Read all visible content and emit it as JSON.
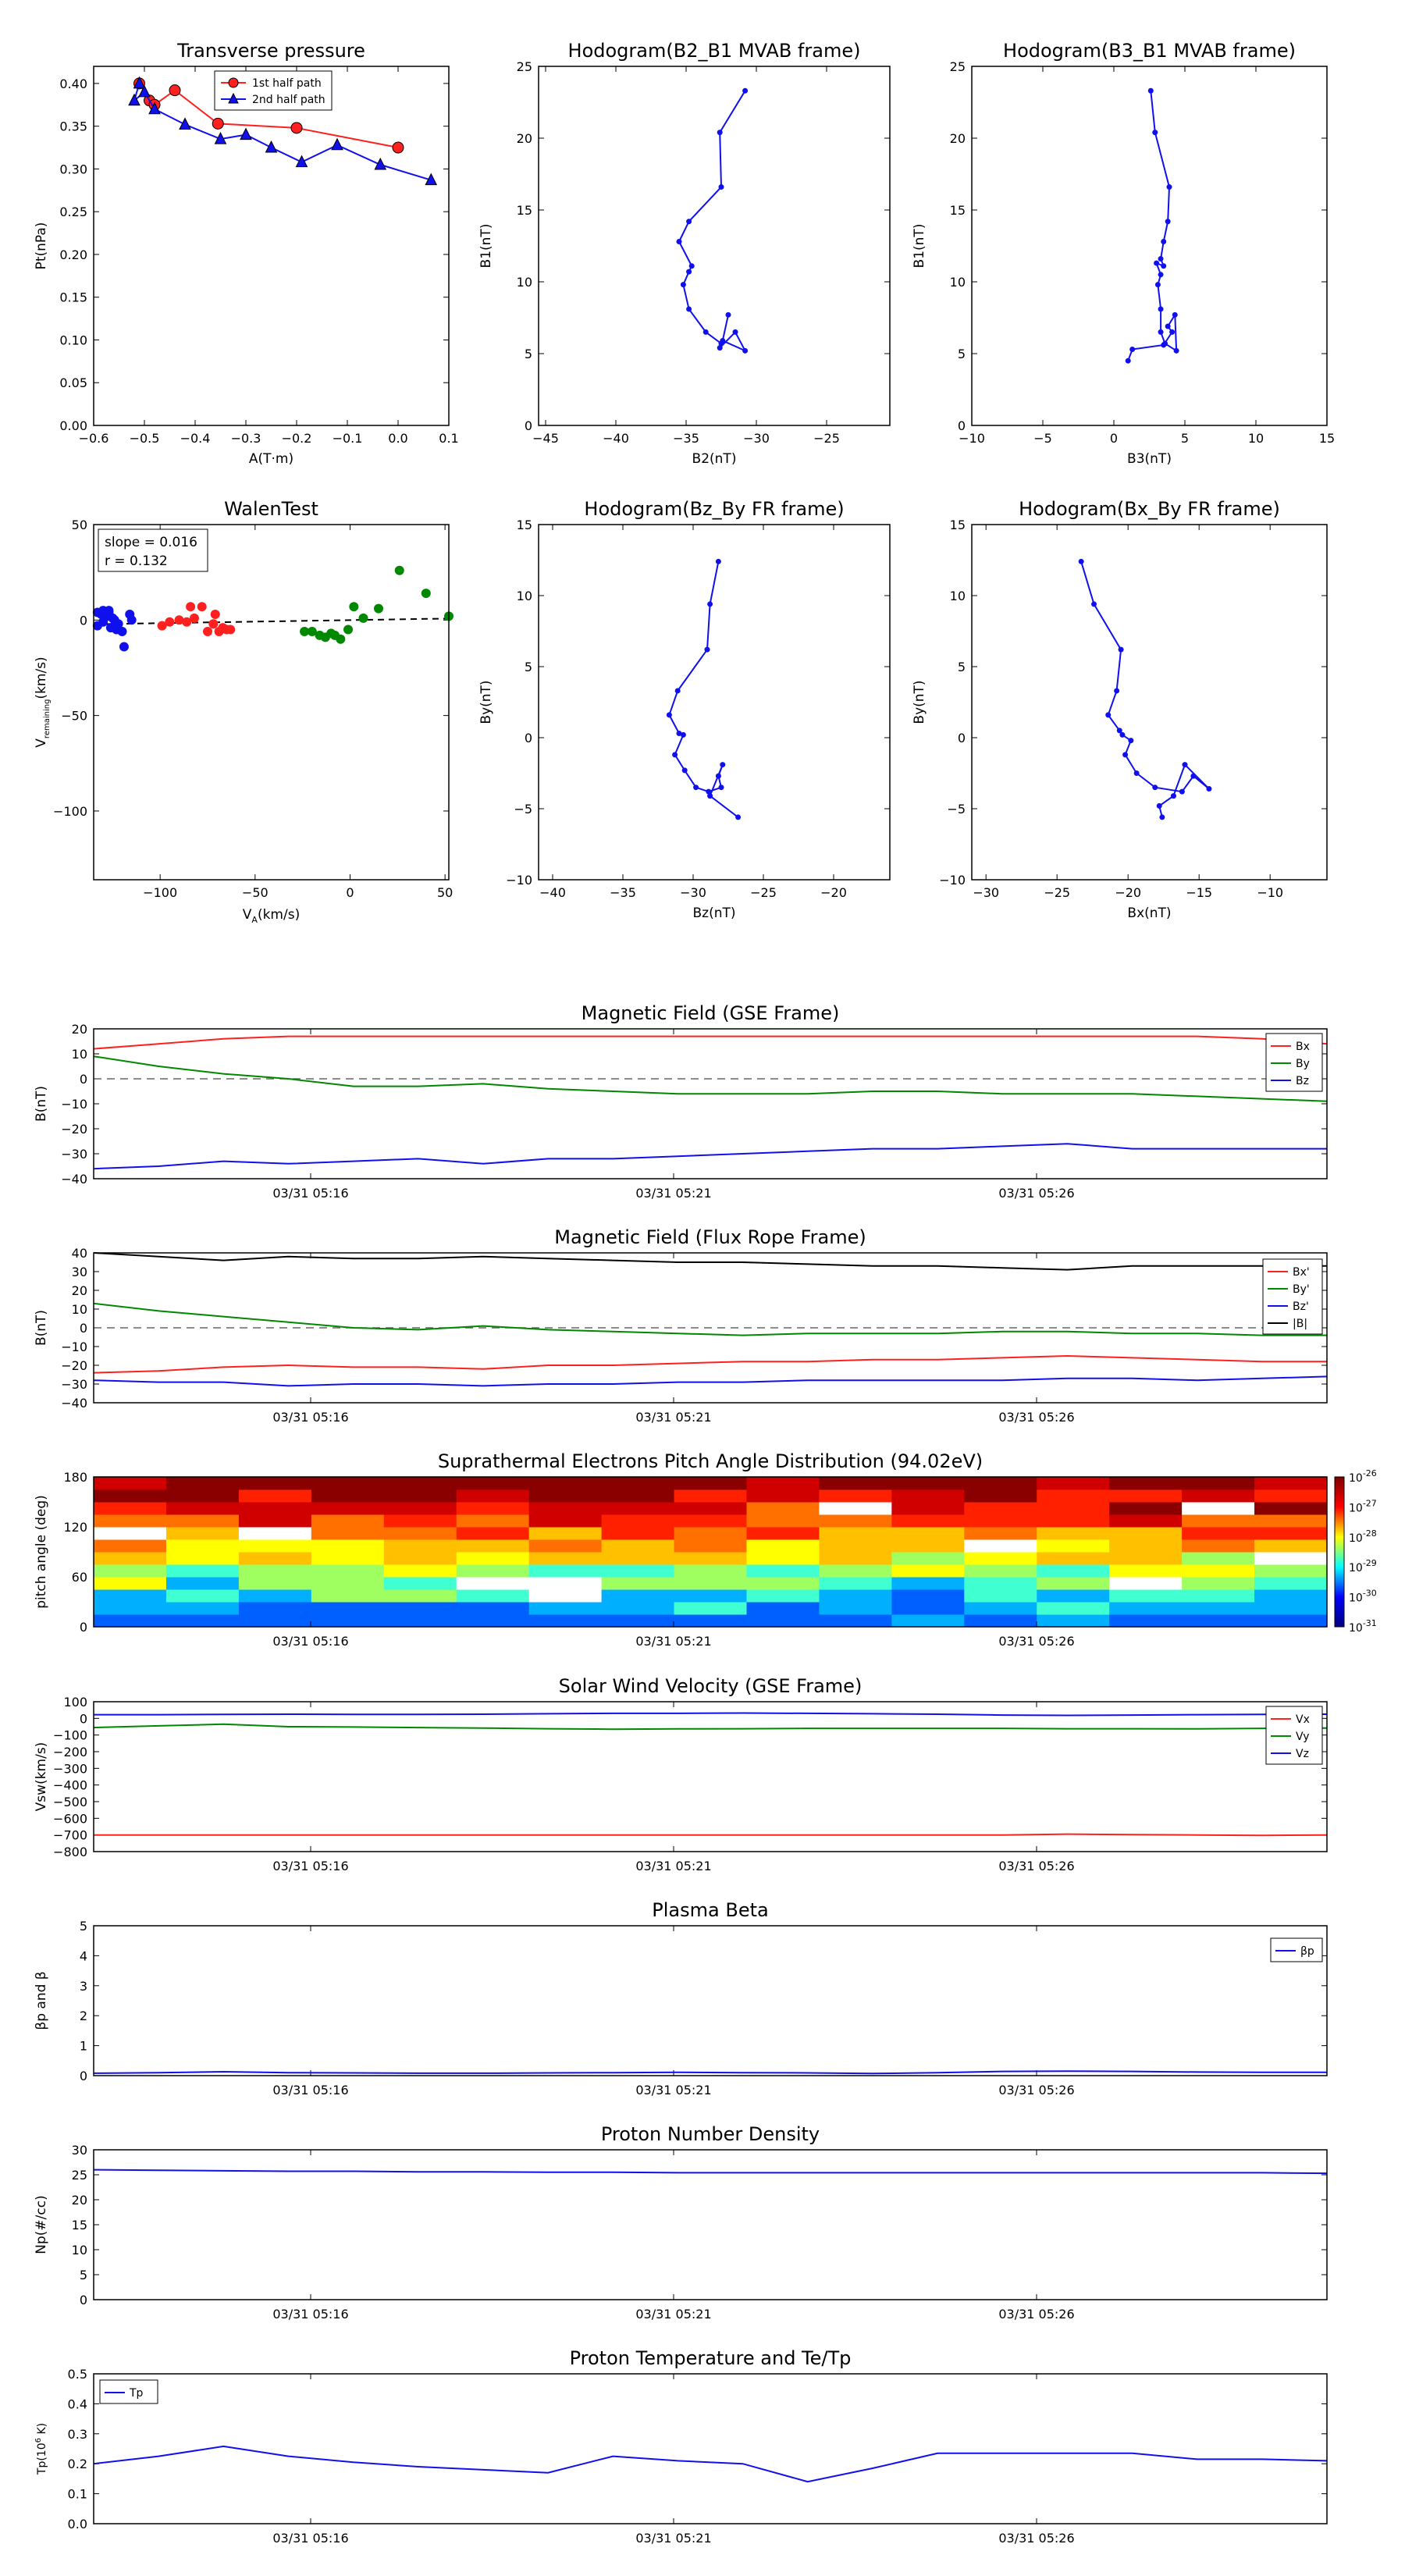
{
  "colors": {
    "red": "#ff2020",
    "green": "#008800",
    "blue": "#1010ee",
    "black": "#000000"
  },
  "time_ticks": [
    "03/31 05:16",
    "03/31 05:21",
    "03/31 05:26"
  ],
  "colorbar": {
    "labels": [
      "10^-26",
      "10^-27",
      "10^-28",
      "10^-29",
      "10^-30",
      "10^-31"
    ]
  },
  "chart_data": [
    {
      "id": "pt",
      "type": "line",
      "title": "Transverse pressure",
      "xlabel": "A(T·m)",
      "ylabel": "Pt(nPa)",
      "xlim": [
        -0.6,
        0.1
      ],
      "ylim": [
        0,
        0.42
      ],
      "xticks": [
        -0.6,
        -0.5,
        -0.4,
        -0.3,
        -0.2,
        -0.1,
        0.0,
        0.1
      ],
      "xtick_labels": [
        "−0.6",
        "−0.5",
        "−0.4",
        "−0.3",
        "−0.2",
        "−0.1",
        "0.0",
        "0.1"
      ],
      "yticks": [
        0,
        0.05,
        0.1,
        0.15,
        0.2,
        0.25,
        0.3,
        0.35,
        0.4
      ],
      "ytick_labels": [
        "0.00",
        "0.05",
        "0.10",
        "0.15",
        "0.20",
        "0.25",
        "0.30",
        "0.35",
        "0.40"
      ],
      "legend": "top-center",
      "series": [
        {
          "name": "1st half path",
          "color": "red",
          "marker": "circle",
          "x": [
            -0.51,
            -0.49,
            -0.48,
            -0.44,
            -0.355,
            -0.2,
            0.0
          ],
          "y": [
            0.4,
            0.38,
            0.375,
            0.392,
            0.353,
            0.348,
            0.325
          ]
        },
        {
          "name": "2nd half path",
          "color": "blue",
          "marker": "triangle",
          "x": [
            -0.51,
            -0.52,
            -0.5,
            -0.48,
            -0.42,
            -0.35,
            -0.3,
            -0.25,
            -0.19,
            -0.12,
            -0.035,
            0.065
          ],
          "y": [
            0.4,
            0.38,
            0.39,
            0.37,
            0.352,
            0.335,
            0.34,
            0.325,
            0.308,
            0.328,
            0.305,
            0.287
          ]
        }
      ]
    },
    {
      "id": "h1",
      "type": "line",
      "title": "Hodogram(B2_B1 MVAB frame)",
      "xlabel": "B2(nT)",
      "ylabel": "B1(nT)",
      "xlim": [
        -45.5,
        -20.5
      ],
      "ylim": [
        0,
        25
      ],
      "xticks": [
        -45,
        -40,
        -35,
        -30,
        -25
      ],
      "xtick_labels": [
        "−45",
        "−40",
        "−35",
        "−30",
        "−25"
      ],
      "yticks": [
        0,
        5,
        10,
        15,
        20,
        25
      ],
      "ytick_labels": [
        "0",
        "5",
        "10",
        "15",
        "20",
        "25"
      ],
      "series": [
        {
          "color": "blue",
          "marker": "dot",
          "x": [
            -30.8,
            -32.6,
            -32.5,
            -34.8,
            -35.5,
            -34.6,
            -34.8,
            -35.2,
            -34.8,
            -33.6,
            -32.5,
            -32.6,
            -31.5,
            -30.8,
            -32.4,
            -32.0
          ],
          "y": [
            23.3,
            20.4,
            16.6,
            14.2,
            12.8,
            11.1,
            10.7,
            9.8,
            8.1,
            6.5,
            5.7,
            5.4,
            6.5,
            5.2,
            5.9,
            7.7
          ]
        }
      ]
    },
    {
      "id": "h2",
      "type": "line",
      "title": "Hodogram(B3_B1 MVAB frame)",
      "xlabel": "B3(nT)",
      "ylabel": "B1(nT)",
      "xlim": [
        -10,
        15
      ],
      "ylim": [
        0,
        25
      ],
      "xticks": [
        -10,
        -5,
        0,
        5,
        10,
        15
      ],
      "xtick_labels": [
        "−10",
        "−5",
        "0",
        "5",
        "10",
        "15"
      ],
      "yticks": [
        0,
        5,
        10,
        15,
        20,
        25
      ],
      "ytick_labels": [
        "0",
        "5",
        "10",
        "15",
        "20",
        "25"
      ],
      "series": [
        {
          "color": "blue",
          "marker": "dot",
          "x": [
            2.6,
            2.9,
            3.9,
            3.8,
            3.5,
            3.3,
            3.5,
            3.0,
            3.3,
            3.1,
            3.3,
            3.3,
            3.6,
            4.4,
            4.3,
            3.8,
            4.1,
            3.5,
            1.3,
            1.0
          ],
          "y": [
            23.3,
            20.4,
            16.6,
            14.2,
            12.8,
            11.6,
            11.1,
            11.3,
            10.5,
            9.8,
            8.1,
            6.5,
            5.7,
            5.2,
            7.7,
            6.9,
            6.5,
            5.6,
            5.3,
            4.5
          ]
        }
      ]
    },
    {
      "id": "walen",
      "type": "scatter",
      "title": "WalenTest",
      "xlabel": "V_A(km/s)",
      "ylabel": "V_remaining(km/s)",
      "xlim": [
        -135,
        52
      ],
      "ylim": [
        -136,
        50
      ],
      "xticks": [
        -100,
        -50,
        0,
        50
      ],
      "xtick_labels": [
        "−100",
        "−50",
        "0",
        "50"
      ],
      "yticks": [
        50,
        0,
        -50,
        -100
      ],
      "ytick_labels": [
        "50",
        "0",
        "−50",
        "−100"
      ],
      "annotation": {
        "slope": "slope = 0.016",
        "r": "r = 0.132"
      },
      "fit": {
        "x": [
          -135,
          52
        ],
        "y": [
          -2.2,
          0.8
        ]
      },
      "series": [
        {
          "color": "blue",
          "x": [
            -133,
            -131,
            -130,
            -128,
            -127,
            -126,
            -125,
            -124,
            -124,
            -123,
            -122,
            -120,
            -119,
            -116,
            -133,
            -130,
            -127,
            -115
          ],
          "y": [
            4,
            3,
            5,
            2,
            4,
            -4,
            1,
            0,
            -3,
            -5,
            -2,
            -6,
            -14,
            3,
            -3,
            -1,
            5,
            0
          ]
        },
        {
          "color": "red",
          "x": [
            -99,
            -95,
            -90,
            -86,
            -84,
            -82,
            -78,
            -75,
            -72,
            -71,
            -69,
            -67,
            -65,
            -63
          ],
          "y": [
            -3,
            -1,
            0,
            -1,
            7,
            1,
            7,
            -6,
            -2,
            3,
            -6,
            -4,
            -5,
            -5
          ]
        },
        {
          "color": "green",
          "x": [
            -24,
            -20,
            -16,
            -13,
            -10,
            -8,
            -5,
            -1,
            2,
            7,
            15,
            26,
            40,
            52
          ],
          "y": [
            -6,
            -6,
            -8,
            -9,
            -7,
            -8,
            -10,
            -5,
            7,
            1,
            6,
            26,
            14,
            2
          ]
        }
      ]
    },
    {
      "id": "h3",
      "type": "line",
      "title": "Hodogram(Bz_By FR frame)",
      "xlabel": "Bz(nT)",
      "ylabel": "By(nT)",
      "xlim": [
        -41,
        -16
      ],
      "ylim": [
        -10,
        15
      ],
      "xticks": [
        -40,
        -35,
        -30,
        -25,
        -20
      ],
      "xtick_labels": [
        "−40",
        "−35",
        "−30",
        "−25",
        "−20"
      ],
      "yticks": [
        -10,
        -5,
        0,
        5,
        10,
        15
      ],
      "ytick_labels": [
        "−10",
        "−5",
        "0",
        "5",
        "10",
        "15"
      ],
      "series": [
        {
          "color": "blue",
          "marker": "dot",
          "x": [
            -28.2,
            -28.8,
            -29.0,
            -31.1,
            -31.7,
            -31.0,
            -30.7,
            -31.3,
            -30.6,
            -29.8,
            -28.9,
            -28.0,
            -28.2,
            -27.9,
            -28.8,
            -26.8
          ],
          "y": [
            12.4,
            9.4,
            6.2,
            3.3,
            1.6,
            0.3,
            0.2,
            -1.2,
            -2.3,
            -3.5,
            -3.8,
            -3.5,
            -2.7,
            -1.9,
            -4.1,
            -5.6
          ]
        }
      ]
    },
    {
      "id": "h4",
      "type": "line",
      "title": "Hodogram(Bx_By FR frame)",
      "xlabel": "Bx(nT)",
      "ylabel": "By(nT)",
      "xlim": [
        -31,
        -6
      ],
      "ylim": [
        -10,
        15
      ],
      "xticks": [
        -30,
        -25,
        -20,
        -15,
        -10
      ],
      "xtick_labels": [
        "−30",
        "−25",
        "−20",
        "−15",
        "−10"
      ],
      "yticks": [
        -10,
        -5,
        0,
        5,
        10,
        15
      ],
      "ytick_labels": [
        "−10",
        "−5",
        "0",
        "5",
        "10",
        "15"
      ],
      "series": [
        {
          "color": "blue",
          "marker": "dot",
          "x": [
            -23.3,
            -22.4,
            -20.5,
            -20.8,
            -21.4,
            -20.6,
            -20.4,
            -19.8,
            -20.2,
            -19.4,
            -18.1,
            -16.2,
            -15.4,
            -14.3,
            -16.0,
            -16.8,
            -17.8,
            -17.6
          ],
          "y": [
            12.4,
            9.4,
            6.2,
            3.3,
            1.6,
            0.5,
            0.2,
            -0.2,
            -1.2,
            -2.5,
            -3.5,
            -3.8,
            -2.7,
            -3.6,
            -1.9,
            -4.1,
            -4.8,
            -5.6
          ]
        }
      ]
    },
    {
      "id": "mag_gse",
      "type": "line",
      "title": "Magnetic Field (GSE Frame)",
      "ylabel": "B(nT)",
      "ylim": [
        -40,
        20
      ],
      "yticks": [
        20,
        10,
        0,
        -10,
        -20,
        -30,
        -40
      ],
      "ytick_labels": [
        "20",
        "10",
        "0",
        "−10",
        "−20",
        "−30",
        "−40"
      ],
      "zero_line": true,
      "legend": "top-right",
      "series": [
        {
          "name": "Bx",
          "color": "red",
          "values": [
            12,
            14,
            16,
            17,
            17,
            17,
            17,
            17,
            17,
            17,
            17,
            17,
            17,
            17,
            17,
            17,
            17,
            17,
            16,
            14
          ]
        },
        {
          "name": "By",
          "color": "green",
          "values": [
            9,
            5,
            2,
            0,
            -3,
            -3,
            -2,
            -4,
            -5,
            -6,
            -6,
            -6,
            -5,
            -5,
            -6,
            -6,
            -6,
            -7,
            -8,
            -9
          ]
        },
        {
          "name": "Bz",
          "color": "blue",
          "values": [
            -36,
            -35,
            -33,
            -34,
            -33,
            -32,
            -34,
            -32,
            -32,
            -31,
            -30,
            -29,
            -28,
            -28,
            -27,
            -26,
            -28,
            -28,
            -28,
            -28
          ]
        }
      ]
    },
    {
      "id": "mag_fr",
      "type": "line",
      "title": "Magnetic Field (Flux Rope Frame)",
      "ylabel": "B(nT)",
      "ylim": [
        -40,
        40
      ],
      "yticks": [
        40,
        30,
        20,
        10,
        0,
        -10,
        -20,
        -30,
        -40
      ],
      "ytick_labels": [
        "40",
        "30",
        "20",
        "10",
        "0",
        "−10",
        "−20",
        "−30",
        "−40"
      ],
      "zero_line": true,
      "legend": "top-right",
      "series": [
        {
          "name": "Bx'",
          "color": "red",
          "values": [
            -24,
            -23,
            -21,
            -20,
            -21,
            -21,
            -22,
            -20,
            -20,
            -19,
            -18,
            -18,
            -17,
            -17,
            -16,
            -15,
            -16,
            -17,
            -18,
            -18
          ]
        },
        {
          "name": "By'",
          "color": "green",
          "values": [
            13,
            9,
            6,
            3,
            0,
            -1,
            1,
            -1,
            -2,
            -3,
            -4,
            -3,
            -3,
            -3,
            -2,
            -2,
            -3,
            -3,
            -4,
            -4
          ]
        },
        {
          "name": "Bz'",
          "color": "blue",
          "values": [
            -28,
            -29,
            -29,
            -31,
            -30,
            -30,
            -31,
            -30,
            -30,
            -29,
            -29,
            -28,
            -28,
            -28,
            -28,
            -27,
            -27,
            -28,
            -27,
            -26
          ]
        },
        {
          "name": "|B|",
          "color": "black",
          "values": [
            40,
            38,
            36,
            38,
            37,
            37,
            38,
            37,
            36,
            35,
            35,
            34,
            33,
            33,
            32,
            31,
            33,
            33,
            33,
            33
          ]
        }
      ]
    },
    {
      "id": "pad",
      "type": "heatmap",
      "title": "Suprathermal Electrons Pitch Angle Distribution (94.02eV)",
      "ylabel": "pitch angle (deg)",
      "ylim": [
        0,
        180
      ],
      "yticks": [
        180,
        120,
        60,
        0
      ],
      "ytick_labels": [
        "180",
        "120",
        "60",
        "0"
      ],
      "cols": 17,
      "rows": 12
    },
    {
      "id": "vsw",
      "type": "line",
      "title": "Solar Wind Velocity (GSE Frame)",
      "ylabel": "Vsw(km/s)",
      "ylim": [
        -800,
        100
      ],
      "yticks": [
        100,
        0,
        -100,
        -200,
        -300,
        -400,
        -500,
        -600,
        -700,
        -800
      ],
      "ytick_labels": [
        "100",
        "0",
        "−100",
        "−200",
        "−300",
        "−400",
        "−500",
        "−600",
        "−700",
        "−800"
      ],
      "legend": "top-right",
      "series": [
        {
          "name": "Vx",
          "color": "red",
          "values": [
            -700,
            -700,
            -700,
            -700,
            -700,
            -700,
            -700,
            -700,
            -700,
            -700,
            -700,
            -700,
            -700,
            -700,
            -700,
            -695,
            -698,
            -700,
            -703,
            -700
          ]
        },
        {
          "name": "Vy",
          "color": "green",
          "values": [
            -55,
            -45,
            -35,
            -50,
            -52,
            -55,
            -58,
            -62,
            -65,
            -63,
            -62,
            -60,
            -60,
            -60,
            -60,
            -62,
            -62,
            -63,
            -60,
            -58
          ]
        },
        {
          "name": "Vz",
          "color": "blue",
          "values": [
            22,
            22,
            24,
            25,
            24,
            24,
            25,
            28,
            30,
            30,
            32,
            30,
            28,
            25,
            20,
            18,
            20,
            22,
            24,
            25
          ]
        }
      ]
    },
    {
      "id": "beta",
      "type": "line",
      "title": "Plasma Beta",
      "ylabel": "βp and β",
      "ylim": [
        0,
        5
      ],
      "yticks": [
        5,
        4,
        3,
        2,
        1,
        0
      ],
      "ytick_labels": [
        "5",
        "4",
        "3",
        "2",
        "1",
        "0"
      ],
      "legend": "top-right",
      "series": [
        {
          "name": "βp",
          "color": "blue",
          "values": [
            0.08,
            0.1,
            0.13,
            0.1,
            0.09,
            0.08,
            0.08,
            0.09,
            0.1,
            0.11,
            0.1,
            0.09,
            0.07,
            0.1,
            0.14,
            0.15,
            0.14,
            0.12,
            0.11,
            0.11
          ]
        }
      ]
    },
    {
      "id": "np",
      "type": "line",
      "title": "Proton Number Density",
      "ylabel": "Np(#/cc)",
      "ylim": [
        0,
        30
      ],
      "yticks": [
        30,
        25,
        20,
        15,
        10,
        5,
        0
      ],
      "ytick_labels": [
        "30",
        "25",
        "20",
        "15",
        "10",
        "5",
        "0"
      ],
      "series": [
        {
          "name": "Np",
          "color": "blue",
          "values": [
            26,
            25.9,
            25.8,
            25.7,
            25.7,
            25.6,
            25.6,
            25.5,
            25.5,
            25.4,
            25.4,
            25.4,
            25.4,
            25.4,
            25.4,
            25.4,
            25.4,
            25.4,
            25.4,
            25.3
          ]
        }
      ]
    },
    {
      "id": "tp",
      "type": "line",
      "title": "Proton Temperature and Te/Tp",
      "ylabel": "Tp(10^6 K)",
      "ylim": [
        0,
        0.5
      ],
      "yticks": [
        0.5,
        0.4,
        0.3,
        0.2,
        0.1,
        0.0
      ],
      "ytick_labels": [
        "0.5",
        "0.4",
        "0.3",
        "0.2",
        "0.1",
        "0.0"
      ],
      "legend": "top-left",
      "series": [
        {
          "name": "Tp",
          "color": "blue",
          "values": [
            0.2,
            0.225,
            0.258,
            0.225,
            0.205,
            0.19,
            0.18,
            0.17,
            0.225,
            0.21,
            0.2,
            0.14,
            0.185,
            0.235,
            0.235,
            0.235,
            0.235,
            0.215,
            0.215,
            0.21
          ]
        }
      ]
    }
  ]
}
